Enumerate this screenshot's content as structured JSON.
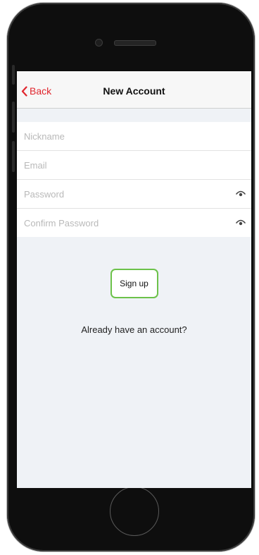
{
  "navbar": {
    "back_label": "Back",
    "title": "New Account"
  },
  "form": {
    "nickname_placeholder": "Nickname",
    "email_placeholder": "Email",
    "password_placeholder": "Password",
    "confirm_password_placeholder": "Confirm Password"
  },
  "actions": {
    "signup_label": "Sign up",
    "already_label": "Already have an account?"
  },
  "colors": {
    "accent_red": "#e0262e",
    "button_border_green": "#6cc24a"
  },
  "icons": {
    "back": "chevron-left-icon",
    "password_toggle": "eye-icon"
  }
}
